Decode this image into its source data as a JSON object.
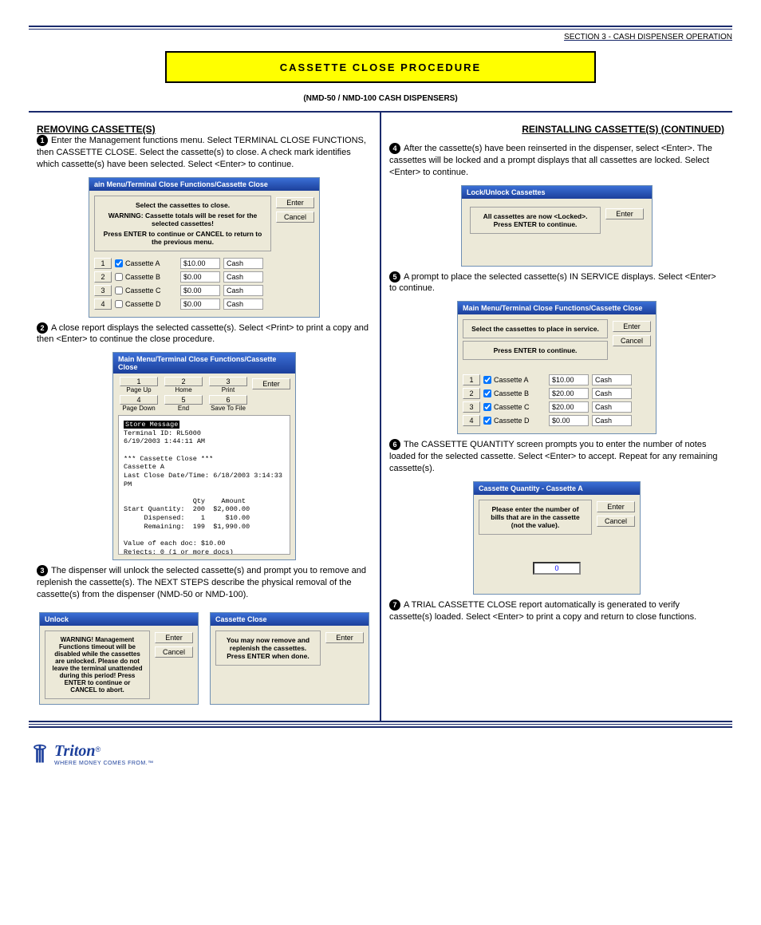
{
  "running_head": "SECTION 3 - CASH DISPENSER OPERATION",
  "banner": "CASSETTE CLOSE PROCEDURE",
  "subhead": "(NMD-50 / NMD-100 CASH DISPENSERS)",
  "left": {
    "title": "REMOVING CASSETTE(S)",
    "step1": "Enter the Management functions menu. Select TERMINAL CLOSE FUNCTIONS, then CASSETTE CLOSE. Select the cassette(s) to close. A check mark identifies which cassette(s) have been selected. Select <Enter> to continue.",
    "win1": {
      "title": "ain Menu/Terminal Close Functions/Cassette Close",
      "msg1": "Select the cassettes to close.",
      "warn": "WARNING: Cassette totals will be reset for the selected cassettes!",
      "msg2": "Press ENTER to continue or CANCEL to return to the previous menu.",
      "rows": [
        {
          "n": "1",
          "chk": true,
          "name": "Cassette A",
          "val": "$10.00",
          "type": "Cash"
        },
        {
          "n": "2",
          "chk": false,
          "name": "Cassette B",
          "val": "$0.00",
          "type": "Cash"
        },
        {
          "n": "3",
          "chk": false,
          "name": "Cassette C",
          "val": "$0.00",
          "type": "Cash"
        },
        {
          "n": "4",
          "chk": false,
          "name": "Cassette D",
          "val": "$0.00",
          "type": "Cash"
        }
      ]
    },
    "step2": "A close report displays the selected cassette(s). Select <Print> to print a copy and then <Enter> to continue the close procedure.",
    "win2": {
      "title": "Main Menu/Terminal Close Functions/Cassette Close",
      "toolbar": [
        [
          "1",
          "Page Up"
        ],
        [
          "2",
          "Home"
        ],
        [
          "3",
          "Print"
        ],
        [
          "4",
          "Page Down"
        ],
        [
          "5",
          "End"
        ],
        [
          "6",
          "Save To File"
        ]
      ],
      "report": "Store Message\nTerminal ID: RL5000\n6/19/2003 1:44:11 AM\n\n*** Cassette Close ***\nCassette A\nLast Close Date/Time: 6/18/2003 3:14:33\nPM\n\n                 Qty    Amount\nStart Quantity:  200  $2,000.00\n     Dispensed:    1     $10.00\n     Remaining:  199  $1,990.00\n\nValue of each doc: $10.00\nRejects: 0 (1 or more docs)"
    },
    "step3": "The dispenser will unlock the selected cassette(s) and prompt you to remove and replenish the cassette(s). The NEXT STEPS describe the physical removal of the cassette(s) from the dispenser (NMD-50 or NMD-100).",
    "dlg_unlock": {
      "title": "Unlock",
      "msg": "WARNING! Management Functions timeout will be disabled while the cassettes are unlocked. Please do not leave the terminal unattended during this period!  Press ENTER to continue or CANCEL to abort."
    },
    "dlg_close": {
      "title": "Cassette Close",
      "msg": "You may now remove and replenish the cassettes. Press ENTER when done."
    }
  },
  "right": {
    "title": "REINSTALLING CASSETTE(S) (CONTINUED)",
    "step4": "After the cassette(s) have been reinserted in the dispenser, select <Enter>. The cassettes will be locked and a prompt displays that all cassettes are locked. Select <Enter> to continue.",
    "dlg_lock": {
      "title": "Lock/Unlock Cassettes",
      "msg": "All cassettes are now <Locked>. Press ENTER to continue."
    },
    "step5": "A prompt to place the selected cassette(s) IN SERVICE displays. Select <Enter> to continue.",
    "step5_u": "IN SERVICE",
    "win3": {
      "title": "Main Menu/Terminal Close Functions/Cassette Close",
      "msg1": "Select the cassettes to place in service.",
      "msg2": "Press ENTER to continue.",
      "rows": [
        {
          "n": "1",
          "chk": true,
          "name": "Cassette A",
          "val": "$10.00",
          "type": "Cash"
        },
        {
          "n": "2",
          "chk": true,
          "name": "Cassette B",
          "val": "$20.00",
          "type": "Cash"
        },
        {
          "n": "3",
          "chk": true,
          "name": "Cassette C",
          "val": "$20.00",
          "type": "Cash"
        },
        {
          "n": "4",
          "chk": true,
          "name": "Cassette D",
          "val": "$0.00",
          "type": "Cash"
        }
      ]
    },
    "step6": "The CASSETTE QUANTITY screen prompts you to enter the number of notes loaded for the selected cassette. Select <Enter> to accept. Repeat for any remaining cassette(s).",
    "dlg_qty": {
      "title": "Cassette Quantity - Cassette A",
      "msg": "Please enter the number of bills that are in the cassette (not the value).",
      "val": "0"
    },
    "step7": "A TRIAL CASSETTE CLOSE report automatically is generated to verify cassette(s) loaded. Select <Enter> to print a copy and return to close functions."
  },
  "btns": {
    "enter": "Enter",
    "cancel": "Cancel"
  },
  "footer": {
    "brand": "Triton",
    "tag": "WHERE MONEY COMES FROM.™"
  }
}
